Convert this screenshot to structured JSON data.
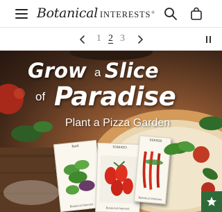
{
  "header": {
    "menu_icon": "hamburger-menu-icon",
    "logo_script": "Botanical",
    "logo_caps": "INTERESTS",
    "logo_reg": "®",
    "search_icon": "search-icon",
    "cart_icon": "shopping-bag-icon"
  },
  "slideshow": {
    "prev_icon": "chevron-left-icon",
    "next_icon": "chevron-right-icon",
    "pages": [
      "1",
      "2",
      "3"
    ],
    "active_page": 2,
    "pause_icon": "pause-icon"
  },
  "hero": {
    "line1_word1": "Grow",
    "line1_small": "a",
    "line1_word2": "Slice",
    "line2_small": "of",
    "line2_word": "Paradise",
    "subtitle": "Plant a Pizza Garden",
    "packets": [
      {
        "title": "Basil",
        "brand": "Botanical Interests"
      },
      {
        "title": "TOMATO",
        "brand": "Botanical Interests"
      },
      {
        "title": "PEPPER",
        "brand": "Botanical Interests"
      }
    ]
  },
  "badge": {
    "icon": "star-icon"
  },
  "colors": {
    "badge_green": "#2f6b3a",
    "text_dark": "#222222",
    "hero_crust": "#c68a4d"
  }
}
